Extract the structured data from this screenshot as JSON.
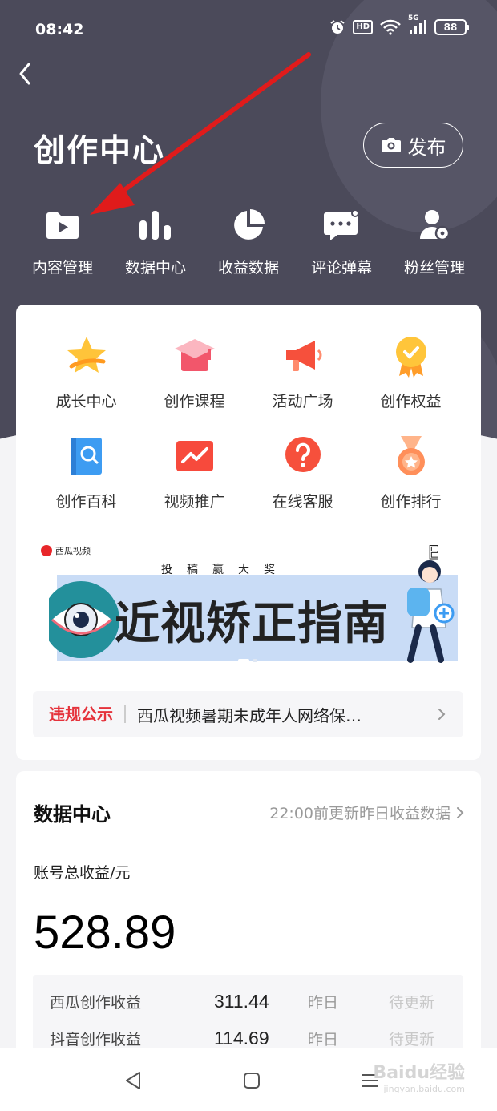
{
  "status_bar": {
    "time": "08:42",
    "hd": "HD",
    "network": "5G",
    "battery": "88"
  },
  "header": {
    "title": "创作中心",
    "publish_label": "发布"
  },
  "quick_actions": [
    {
      "label": "内容管理",
      "icon": "play-folder-icon"
    },
    {
      "label": "数据中心",
      "icon": "bar-chart-icon"
    },
    {
      "label": "收益数据",
      "icon": "pie-chart-icon"
    },
    {
      "label": "评论弹幕",
      "icon": "comment-bubble-icon"
    },
    {
      "label": "粉丝管理",
      "icon": "fan-user-icon"
    }
  ],
  "tools": [
    {
      "label": "成长中心",
      "icon": "star-icon"
    },
    {
      "label": "创作课程",
      "icon": "graduation-cap-icon"
    },
    {
      "label": "活动广场",
      "icon": "megaphone-icon"
    },
    {
      "label": "创作权益",
      "icon": "badge-medal-icon"
    },
    {
      "label": "创作百科",
      "icon": "book-search-icon"
    },
    {
      "label": "视频推广",
      "icon": "trend-up-icon"
    },
    {
      "label": "在线客服",
      "icon": "help-question-icon"
    },
    {
      "label": "创作排行",
      "icon": "ranking-medal-icon"
    }
  ],
  "banner": {
    "brand": "西瓜视频",
    "subtitle": "投稿赢大奖",
    "headline": "近视矫正指南"
  },
  "notice": {
    "tag": "违规公示",
    "text": "西瓜视频暑期未成年人网络保…"
  },
  "data_center": {
    "title": "数据中心",
    "update_note": "22:00前更新昨日收益数据",
    "total_label": "账号总收益/元",
    "total_value": "528.89",
    "rows": [
      {
        "name": "西瓜创作收益",
        "value": "311.44",
        "day": "昨日",
        "pending": "待更新"
      },
      {
        "name": "抖音创作收益",
        "value": "114.69",
        "day": "昨日",
        "pending": "待更新"
      }
    ]
  },
  "watermark": {
    "brand": "Baidu经验",
    "url": "jingyan.baidu.com"
  },
  "colors": {
    "hero_bg": "#4b4a5a",
    "notice_red": "#e5323b",
    "arrow_red": "#e01b1b"
  }
}
